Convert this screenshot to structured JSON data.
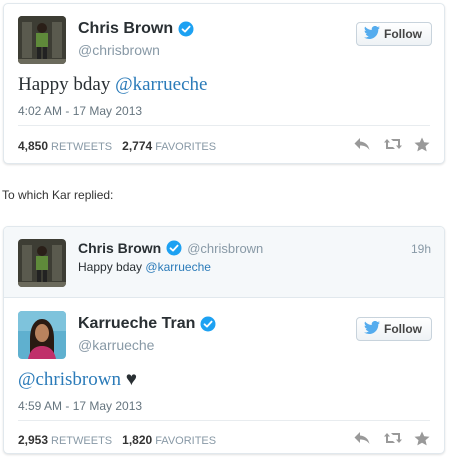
{
  "tweet1": {
    "name": "Chris Brown",
    "handle": "@chrisbrown",
    "follow_label": "Follow",
    "text_plain": "Happy bday ",
    "text_mention": "@karrueche",
    "timestamp": "4:02 AM - 17 May 2013",
    "retweets_count": "4,850",
    "retweets_label": "RETWEETS",
    "favorites_count": "2,774",
    "favorites_label": "FAVORITES"
  },
  "caption": "To which Kar replied:",
  "tweet2": {
    "parent": {
      "name": "Chris Brown",
      "handle": "@chrisbrown",
      "time": "19h",
      "text_plain": "Happy bday ",
      "text_mention": "@karrueche"
    },
    "name": "Karrueche Tran",
    "handle": "@karrueche",
    "follow_label": "Follow",
    "text_mention": "@chrisbrown",
    "text_suffix": " ♥",
    "timestamp": "4:59 AM - 17 May 2013",
    "retweets_count": "2,953",
    "retweets_label": "RETWEETS",
    "favorites_count": "1,820",
    "favorites_label": "FAVORITES"
  },
  "colors": {
    "link": "#2b7bb9",
    "verified": "#1da1f2",
    "action_icon": "#999999",
    "twitter_bird": "#55acee"
  },
  "icons": [
    "verified-badge-icon",
    "twitter-bird-icon",
    "reply-icon",
    "retweet-icon",
    "favorite-star-icon"
  ]
}
